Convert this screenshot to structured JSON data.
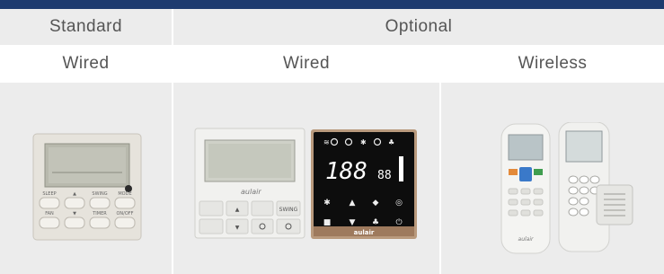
{
  "header": {
    "standard": "Standard",
    "optional": "Optional"
  },
  "subheader": {
    "wired_standard": "Wired",
    "wired_optional": "Wired",
    "wireless": "Wireless"
  },
  "products": {
    "standard_wired": {
      "buttons": [
        "SLEEP",
        "▲",
        "SWING",
        "MODE",
        "FAN",
        "▼",
        "TIMER",
        "ON/OFF"
      ]
    },
    "optional_wired_white": {
      "brand": "aulair",
      "buttons": [
        "▲",
        "SWING",
        "▼",
        "ON/OFF"
      ]
    },
    "optional_wired_black": {
      "brand": "aulair",
      "display": "188",
      "display_small": "88"
    },
    "wireless_remote": {
      "brand": "aulair"
    }
  },
  "colors": {
    "topbar": "#1e3b6f",
    "header_bg": "#ececec",
    "image_bg": "#ececec",
    "text": "#555555"
  }
}
